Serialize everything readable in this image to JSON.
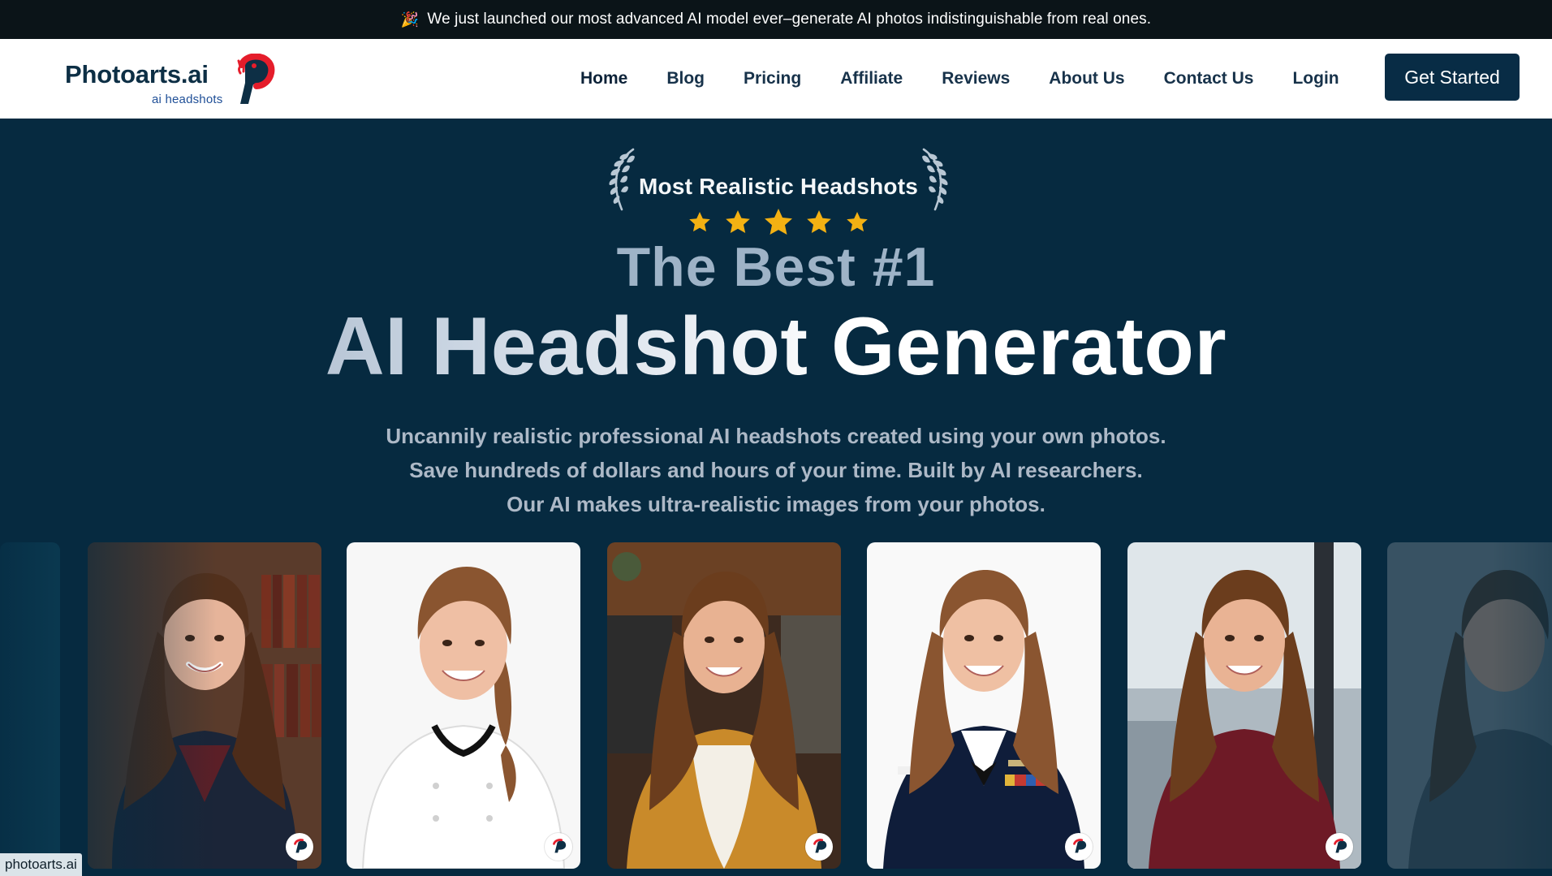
{
  "announcement": {
    "icon": "party-popper-icon",
    "text": "We just launched our most advanced AI model ever–generate AI photos indistinguishable from real ones."
  },
  "header": {
    "logo": {
      "title": "Photoarts.ai",
      "subtitle": "ai headshots",
      "mark_icon": "photoarts-p-logo-icon"
    },
    "nav": [
      {
        "label": "Home",
        "active": true
      },
      {
        "label": "Blog",
        "active": false
      },
      {
        "label": "Pricing",
        "active": false
      },
      {
        "label": "Affiliate",
        "active": false
      },
      {
        "label": "Reviews",
        "active": false
      },
      {
        "label": "About Us",
        "active": false
      },
      {
        "label": "Contact Us",
        "active": false
      },
      {
        "label": "Login",
        "active": false
      }
    ],
    "cta_label": "Get Started"
  },
  "hero": {
    "badge_title": "Most Realistic Headshots",
    "rating_stars": 5,
    "headline_small": "The Best #1",
    "headline_big": "AI Headshot Generator",
    "subtext_lines": [
      "Uncannily realistic professional AI headshots created using your own photos.",
      "Save hundreds of dollars and hours of your time. Built by AI researchers.",
      "Our AI makes ultra-realistic images from your photos."
    ]
  },
  "gallery": [
    {
      "name": "library-blazer-headshot",
      "background": "library"
    },
    {
      "name": "chef-headshot",
      "background": "white"
    },
    {
      "name": "mustard-blazer-headshot",
      "background": "cafe"
    },
    {
      "name": "military-uniform-headshot",
      "background": "white"
    },
    {
      "name": "burgundy-blouse-headshot",
      "background": "city-window"
    },
    {
      "name": "partial-right-headshot",
      "background": "gray"
    }
  ],
  "site_tag": "photoarts.ai",
  "colors": {
    "announcement_bg": "#0b1418",
    "header_bg": "#ffffff",
    "hero_bg": "#062a40",
    "cta_bg": "#082c45",
    "star": "#f3b113",
    "headline_small": "#9eb3c7",
    "subtext": "#adb9c7"
  }
}
